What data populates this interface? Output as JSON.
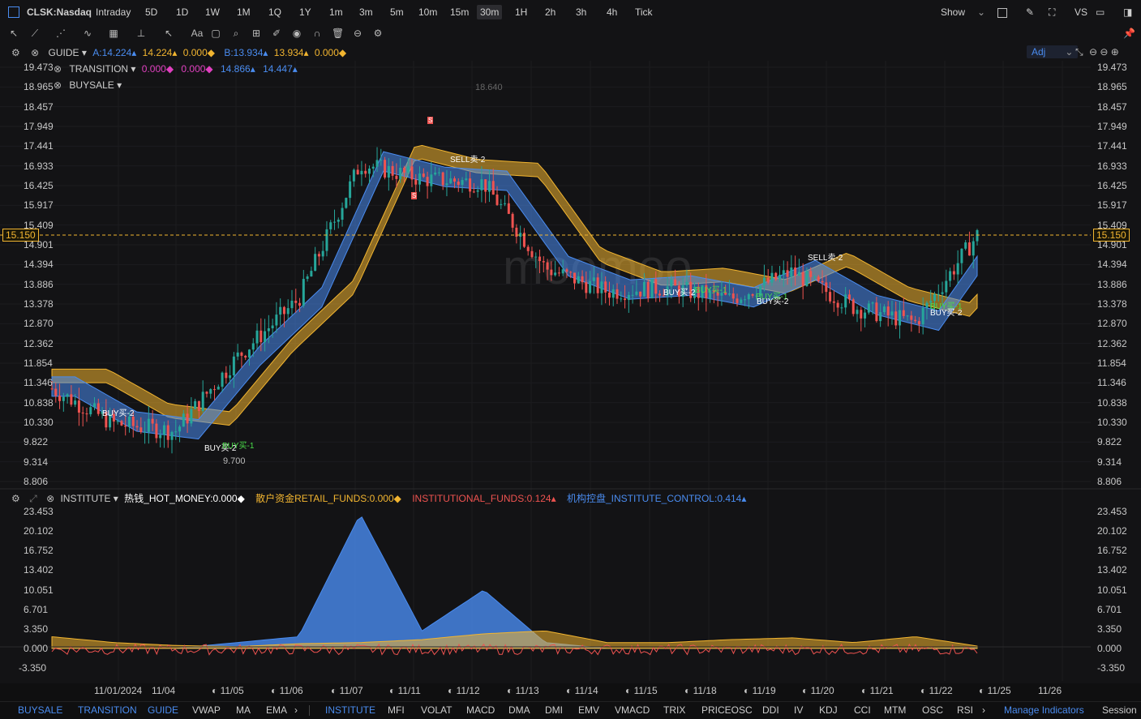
{
  "header": {
    "symbol": "CLSK:Nasdaq",
    "timeframes": [
      "Intraday",
      "5D",
      "1D",
      "1W",
      "1M",
      "1Q",
      "1Y",
      "1m",
      "3m",
      "5m",
      "10m",
      "15m",
      "30m",
      "1H",
      "2h",
      "3h",
      "4h",
      "Tick"
    ],
    "selected_timeframe": "30m",
    "show_label": "Show",
    "vs_label": "VS"
  },
  "legend": {
    "guide_label": "GUIDE",
    "guide_values": [
      "A:14.224",
      "14.224",
      "0.000",
      "B:13.934",
      "13.934",
      "0.000"
    ],
    "transition_label": "TRANSITION",
    "transition_values": [
      "0.000",
      "0.000",
      "14.866",
      "14.447"
    ],
    "buysale_label": "BUYSALE",
    "adj_label": "Adj",
    "institute_label": "INSTITUTE",
    "institute_values": [
      "热钱_HOT_MONEY:0.000",
      "散户资金RETAIL_FUNDS:0.000",
      "INSTITUTIONAL_FUNDS:0.124",
      "机构控盘_INSTITUTE_CONTROL:0.414"
    ]
  },
  "price_axis": [
    "19.473",
    "18.965",
    "18.457",
    "17.949",
    "17.441",
    "16.933",
    "16.425",
    "15.917",
    "15.409",
    "14.901",
    "14.394",
    "13.886",
    "13.378",
    "12.870",
    "12.362",
    "11.854",
    "11.346",
    "10.838",
    "10.330",
    "9.822",
    "9.314",
    "8.806"
  ],
  "current_price": "15.150",
  "annotations": {
    "high": "18.640",
    "low": "9.700",
    "signals": [
      "S",
      "S",
      "SELL卖-2",
      "SELL卖-2",
      "BUY买-2",
      "BUY买-2",
      "BUY买-1",
      "BUY买-2",
      "BUY买-1",
      "BUY买-1",
      "BUY买-2",
      "BUY买-1",
      "BUY买-2"
    ]
  },
  "indicator_axis": [
    "23.453",
    "20.102",
    "16.752",
    "13.402",
    "10.051",
    "6.701",
    "3.350",
    "0.000",
    "-3.350"
  ],
  "time_axis": [
    "11/01/2024",
    "11/04",
    "11/05",
    "11/06",
    "11/07",
    "11/11",
    "11/12",
    "11/13",
    "11/14",
    "11/15",
    "11/18",
    "11/19",
    "11/20",
    "11/21",
    "11/22",
    "11/25",
    "11/26"
  ],
  "bottom_tabs": {
    "main": [
      "BUYSALE",
      "TRANSITION",
      "GUIDE",
      "VWAP",
      "MA",
      "EMA"
    ],
    "sub": [
      "INSTITUTE",
      "MFI",
      "VOLAT",
      "MACD",
      "DMA",
      "DMI",
      "EMV",
      "VMACD",
      "TRIX",
      "PRICEOSC",
      "DDI",
      "IV",
      "KDJ",
      "CCI",
      "MTM",
      "OSC",
      "RSI"
    ],
    "manage": "Manage Indicators",
    "session": "Session"
  },
  "colors": {
    "accent": "#4a8cf0",
    "up_candle": "#26a69a",
    "down_candle": "#ef5350",
    "gold": "#f2b530",
    "magenta": "#e040c0",
    "blue_band": "#4a8cf0"
  },
  "chart_data": [
    {
      "type": "candlestick",
      "title": "CLSK:Nasdaq",
      "ylim": [
        8.806,
        19.473
      ],
      "annotated_high": 18.64,
      "annotated_low": 9.7,
      "last": 15.15,
      "approx_close_path": [
        {
          "x": "11/01/2024",
          "y": 11.2
        },
        {
          "x": "11/04",
          "y": 10.3
        },
        {
          "x": "11/05",
          "y": 10.1
        },
        {
          "x": "11/06",
          "y": 12.0
        },
        {
          "x": "11/07",
          "y": 13.5
        },
        {
          "x": "11/11",
          "y": 17.0
        },
        {
          "x": "11/12",
          "y": 16.6
        },
        {
          "x": "11/13",
          "y": 16.5
        },
        {
          "x": "11/14",
          "y": 14.3
        },
        {
          "x": "11/15",
          "y": 13.7
        },
        {
          "x": "11/18",
          "y": 13.8
        },
        {
          "x": "11/19",
          "y": 13.5
        },
        {
          "x": "11/20",
          "y": 14.2
        },
        {
          "x": "11/21",
          "y": 13.3
        },
        {
          "x": "11/22",
          "y": 12.9
        },
        {
          "x": "11/25",
          "y": 15.15
        }
      ]
    },
    {
      "type": "area",
      "title": "INSTITUTE",
      "ylim": [
        -3.35,
        23.453
      ],
      "series": [
        {
          "name": "INSTITUTIONAL_FUNDS",
          "values": [
            0,
            0,
            0,
            1,
            2,
            23,
            3,
            10,
            1,
            0,
            0,
            0,
            0,
            0,
            0,
            0.1
          ]
        },
        {
          "name": "机构控盘_INSTITUTE_CONTROL",
          "values": [
            2,
            1,
            0.5,
            0.3,
            0.8,
            1,
            1.5,
            2.5,
            3,
            1,
            1,
            1.5,
            1.8,
            1,
            2,
            0.4
          ]
        }
      ]
    }
  ]
}
